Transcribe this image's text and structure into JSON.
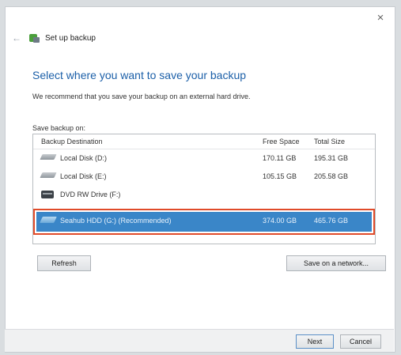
{
  "window": {
    "close_glyph": "×"
  },
  "nav": {
    "back_glyph": "←",
    "title": "Set up backup"
  },
  "main": {
    "heading": "Select where you want to save your backup",
    "subtext": "We recommend that you save your backup on an external hard drive.",
    "list_label": "Save backup on:"
  },
  "table": {
    "headers": {
      "destination": "Backup Destination",
      "free": "Free Space",
      "total": "Total Size"
    },
    "rows": [
      {
        "name": "Local Disk (D:)",
        "free": "170.11 GB",
        "total": "195.31 GB",
        "icon": "hard-drive-icon"
      },
      {
        "name": "Local Disk (E:)",
        "free": "105.15 GB",
        "total": "205.58 GB",
        "icon": "hard-drive-icon"
      },
      {
        "name": "DVD RW Drive (F:)",
        "free": "",
        "total": "",
        "icon": "dvd-drive-icon"
      },
      {
        "name": "Seahub HDD (G:) (Recommended)",
        "free": "374.00 GB",
        "total": "465.76 GB",
        "icon": "usb-drive-icon",
        "selected": true
      }
    ]
  },
  "buttons": {
    "refresh": "Refresh",
    "network": "Save on a network...",
    "next": "Next",
    "cancel": "Cancel"
  },
  "colors": {
    "accent": "#1b5fa8",
    "selection": "#3a86c8",
    "highlight_box": "#e04b2a"
  }
}
